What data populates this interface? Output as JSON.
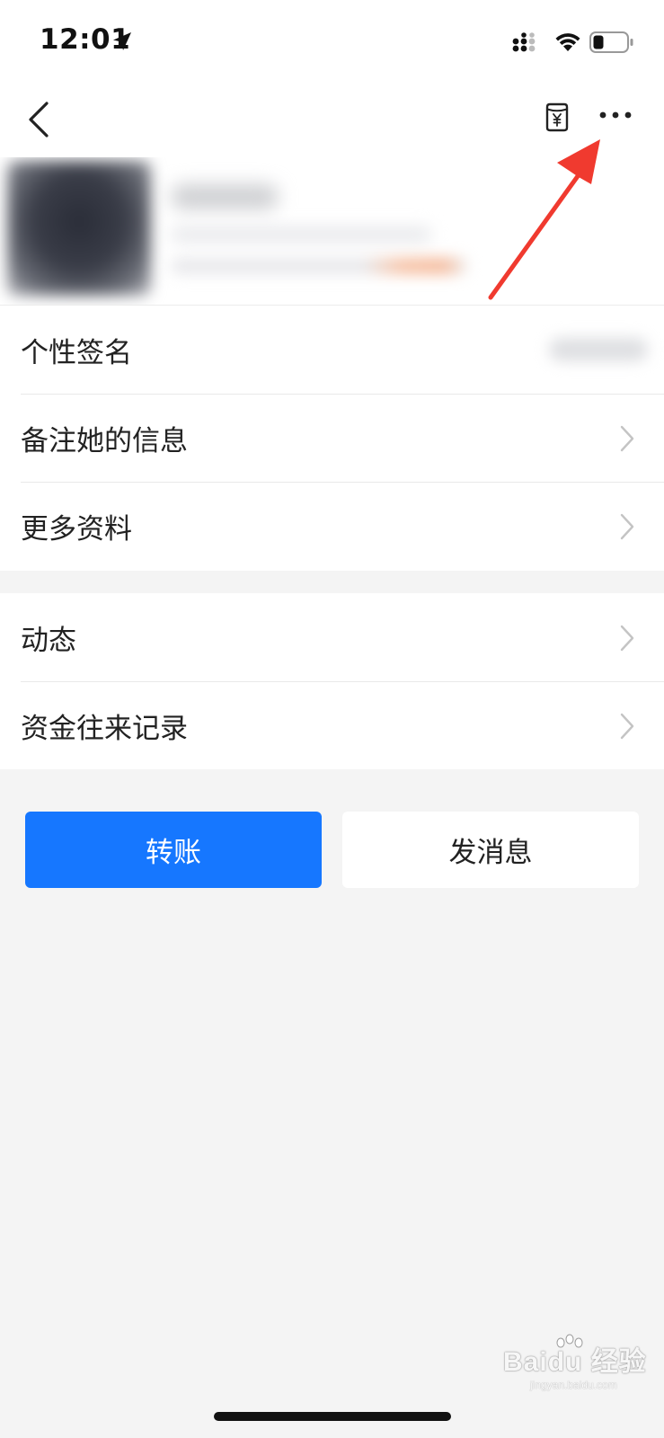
{
  "status_bar": {
    "time": "12:01"
  },
  "nav": {
    "icons": [
      "back-icon",
      "money-jar-icon",
      "more-icon"
    ]
  },
  "profile_rows": [
    {
      "label": "个性签名"
    },
    {
      "label": "备注她的信息"
    },
    {
      "label": "更多资料"
    }
  ],
  "activity_rows": [
    {
      "label": "动态"
    },
    {
      "label": "资金往来记录"
    }
  ],
  "actions": {
    "transfer_label": "转账",
    "message_label": "发消息"
  },
  "watermark": {
    "brand": "Bai",
    "brand2": "du",
    "brand_cn": "经验",
    "url": "jingyan.baidu.com"
  },
  "colors": {
    "accent": "#1677ff",
    "background": "#f4f4f4",
    "annotation_arrow": "#f03a2f"
  }
}
